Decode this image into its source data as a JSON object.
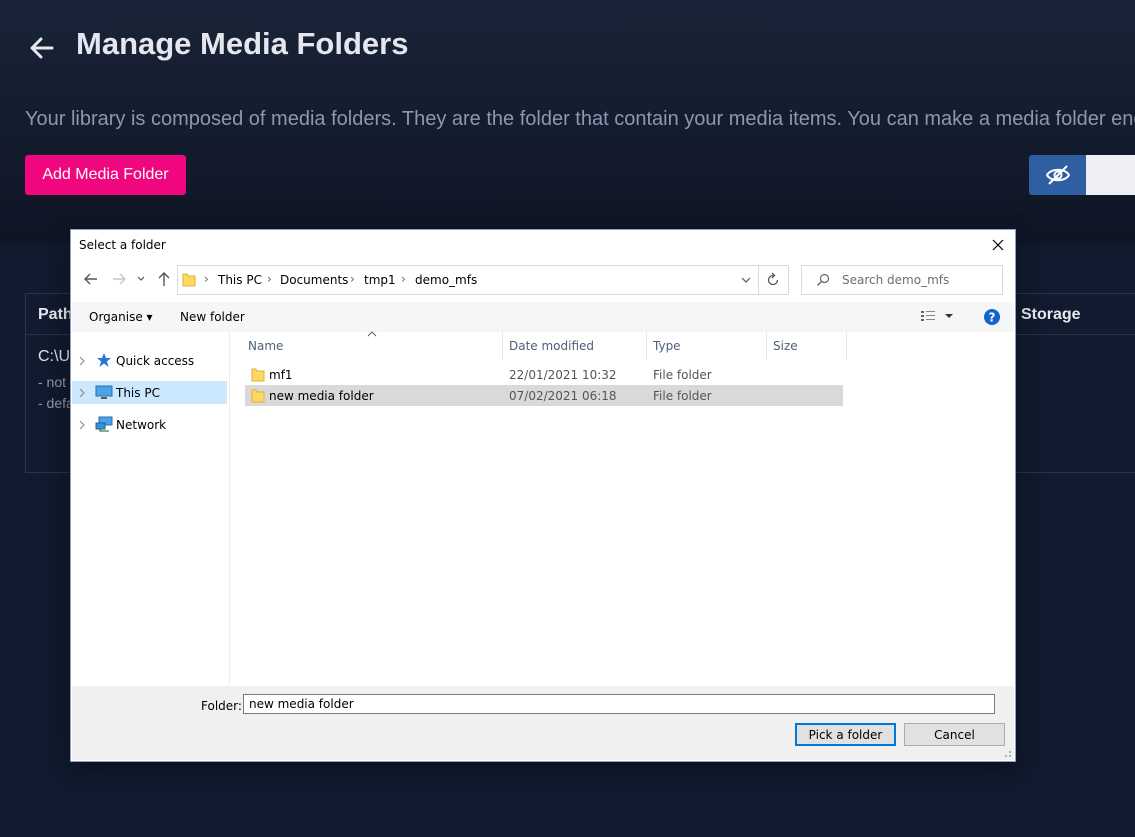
{
  "app": {
    "title": "Manage Media Folders",
    "description": "Your library is composed of media folders. They are the folder that contain your media items. You can make a media folder enc",
    "add_button_label": "Add Media Folder",
    "table": {
      "headers": [
        "Path",
        "Storage"
      ],
      "row": {
        "path": "C:\\Us",
        "notes": [
          "- not",
          "- defa"
        ]
      }
    }
  },
  "dialog": {
    "title": "Select a folder",
    "breadcrumbs": [
      "This PC",
      "Documents",
      "tmp1",
      "demo_mfs"
    ],
    "search_placeholder": "Search demo_mfs",
    "toolbar": {
      "organise": "Organise",
      "new_folder": "New folder"
    },
    "nav": [
      {
        "label": "Quick access",
        "icon": "quick-access-star-icon"
      },
      {
        "label": "This PC",
        "icon": "computer-icon",
        "selected": true
      },
      {
        "label": "Network",
        "icon": "network-icon"
      }
    ],
    "columns": [
      "Name",
      "Date modified",
      "Type",
      "Size"
    ],
    "files": [
      {
        "name": "mf1",
        "date": "22/01/2021 10:32",
        "type": "File folder",
        "size": ""
      },
      {
        "name": "new media folder",
        "date": "07/02/2021 06:18",
        "type": "File folder",
        "size": "",
        "selected": true
      }
    ],
    "folder_label": "Folder:",
    "folder_value": "new media folder",
    "pick_button": "Pick a folder",
    "cancel_button": "Cancel"
  },
  "colors": {
    "background": "#111a2e",
    "accent_pink": "#f0077f",
    "toggle_blue": "#2f5fa3",
    "selection_blue": "#cce8ff"
  }
}
